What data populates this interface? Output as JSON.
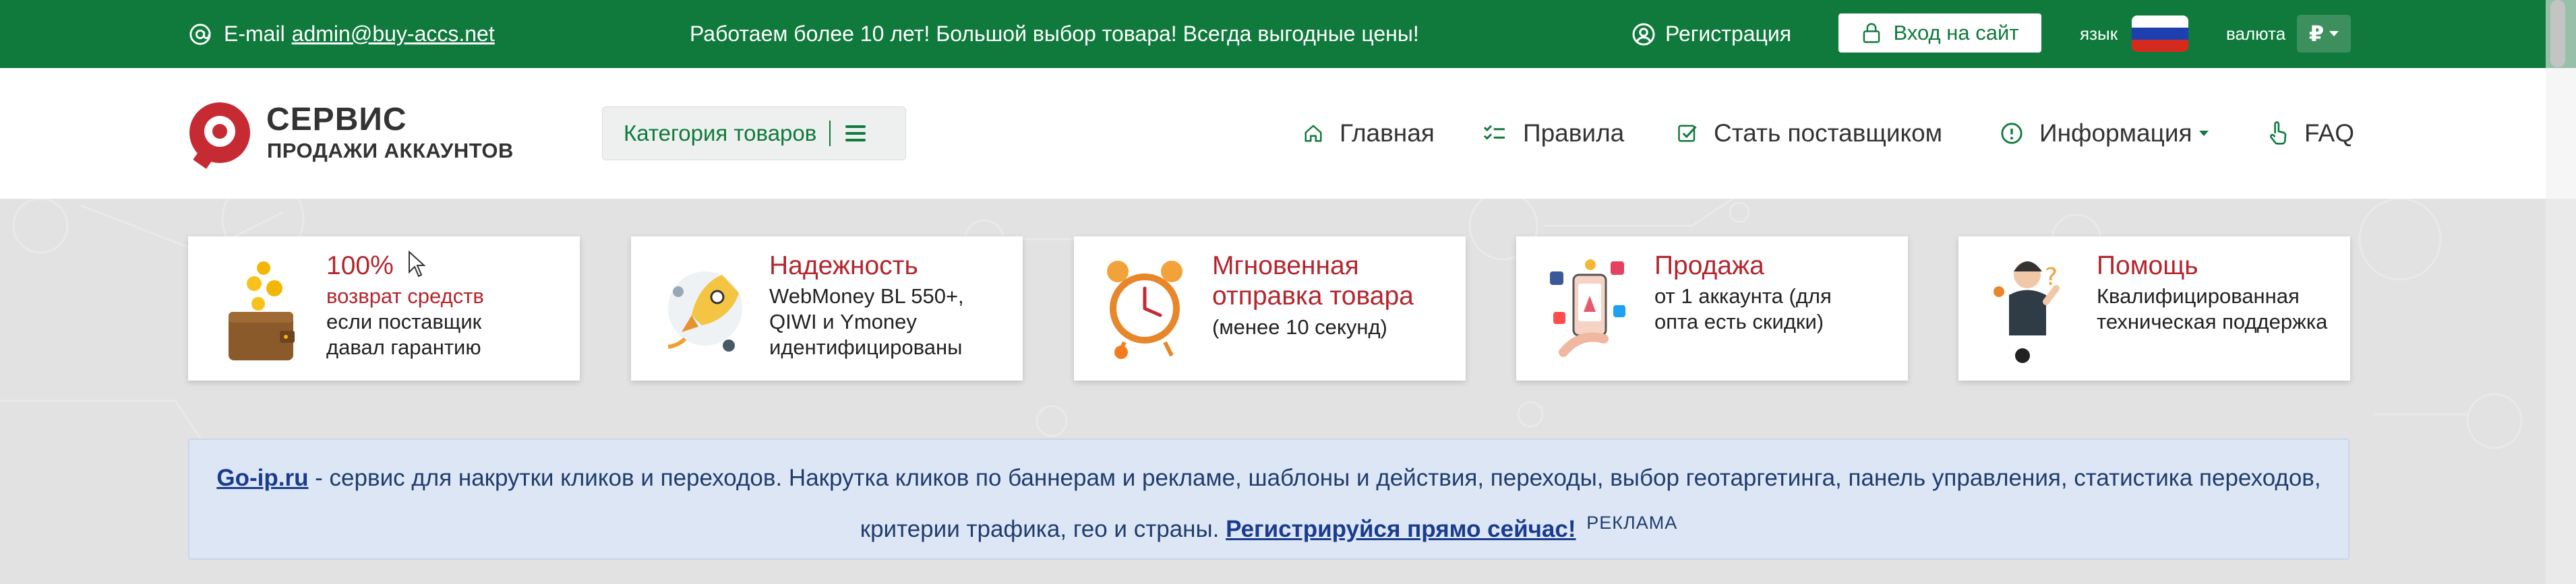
{
  "topbar": {
    "email_label": "E-mail",
    "email": "admin@buy-accs.net",
    "slogan": "Работаем более 10 лет! Большой выбор товара! Всегда выгодные цены!",
    "register": "Регистрация",
    "login": "Вход на сайт",
    "lang_label": "язык",
    "currency_label": "валюта",
    "currency_symbol": "₽"
  },
  "header": {
    "logo_title": "СЕРВИС",
    "logo_subtitle": "ПРОДАЖИ АККАУНТОВ",
    "category_button": "Категория товаров",
    "nav": [
      {
        "label": "Главная",
        "icon": "home-icon"
      },
      {
        "label": "Правила",
        "icon": "checklist-icon"
      },
      {
        "label": "Стать поставщиком",
        "icon": "checkbox-icon"
      },
      {
        "label": "Информация",
        "icon": "info-icon"
      },
      {
        "label": "FAQ",
        "icon": "pointer-hand-icon"
      }
    ]
  },
  "features": [
    {
      "title": "100%",
      "accent": "возврат средств",
      "desc": "если поставщик давал гарантию",
      "icon": "wallet-coins-icon"
    },
    {
      "title": "Надежность",
      "desc": "WebMoney BL 550+, QIWI и Ymoney идентифицированы",
      "icon": "rocket-icon"
    },
    {
      "title": "Мгновенная отправка товара",
      "desc": "(менее 10 секунд)",
      "icon": "alarm-clock-icon"
    },
    {
      "title": "Продажа",
      "desc": "от 1 аккаунта (для опта есть скидки)",
      "icon": "phone-social-icon"
    },
    {
      "title": "Помощь",
      "desc": "Квалифицированная техническая поддержка",
      "icon": "support-person-icon"
    }
  ],
  "ad": {
    "link": "Go-ip.ru",
    "text": " - сервис для накрутки кликов и переходов. Накрутка кликов по баннерам и рекламе, шаблоны и действия, переходы, выбор геотаргетинга, панель управления, статистика переходов, критерии трафика, гео и страны.",
    "cta": "Регистрируйся прямо сейчас!",
    "tag": "РЕКЛАМА"
  },
  "colors": {
    "brand_green": "#0f7a3c",
    "accent_red": "#b3262d",
    "ad_bg": "#dde6f5"
  }
}
